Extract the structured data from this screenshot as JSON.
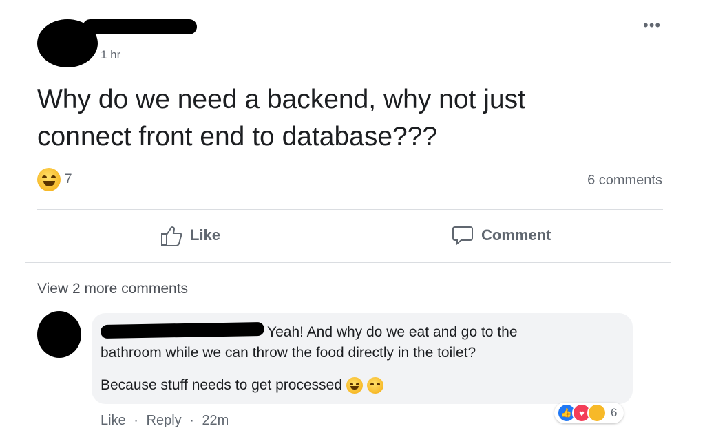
{
  "post": {
    "timestamp": "1 hr",
    "more_icon": "more-horizontal-icon",
    "text_line1": "Why do we need a backend, why not just",
    "text_line2": "connect front end to database???",
    "reaction_count": "7",
    "comments_count": "6 comments"
  },
  "actions": {
    "like_label": "Like",
    "comment_label": "Comment"
  },
  "comments": {
    "view_more": "View 2 more comments",
    "comment": {
      "text_line1": "Yeah! And why do we eat and go to the",
      "text_line2": "bathroom while we can throw the food directly in the toilet?",
      "text_line3": "Because stuff needs to get processed",
      "reaction_count": "6",
      "like_label": "Like",
      "reply_label": "Reply",
      "time": "22m",
      "separator": "·"
    }
  },
  "colors": {
    "like_blue": "#2078f4",
    "love_red": "#f33e58",
    "haha_yellow": "#f7b928",
    "secondary_text": "#616770"
  }
}
